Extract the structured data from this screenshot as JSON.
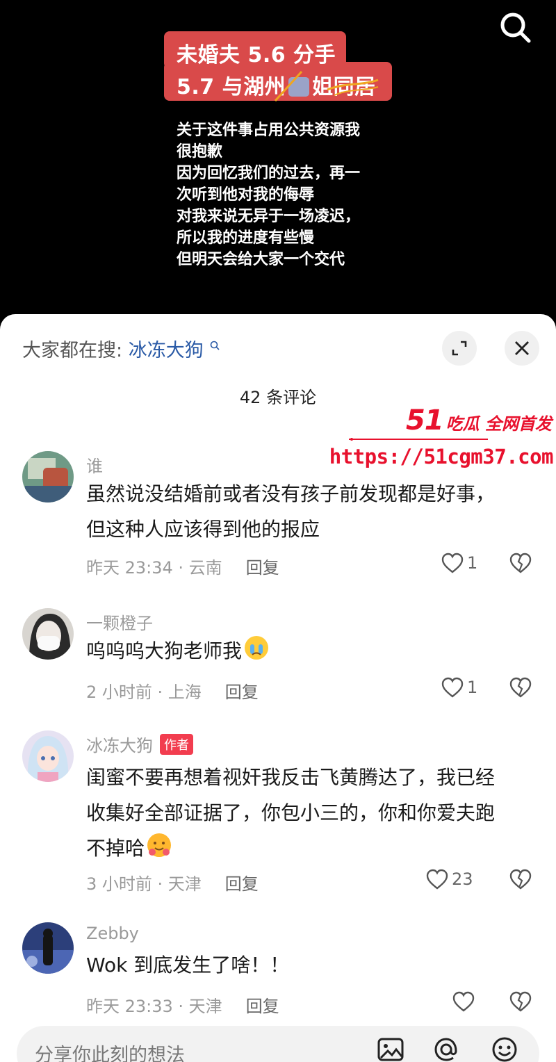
{
  "video": {
    "title_line1": "未婚夫 5.6 分手",
    "title_line2_pre": "5.7 与湖州",
    "title_line2_post": "姐同居",
    "statement_lines": [
      "关于这件事占用公共资源我",
      "很抱歉",
      "因为回忆我们的过去，再一",
      "次听到他对我的侮辱",
      "对我来说无异于一场凌迟，",
      "所以我的进度有些慢",
      "但明天会给大家一个交代"
    ]
  },
  "sheet": {
    "hot_search_label": "大家都在搜:",
    "hot_search_term": "冰冻大狗",
    "comment_count": "42 条评论"
  },
  "watermark": {
    "brand_number": "51",
    "slogan": "吃瓜 全网首发",
    "url": "https://51cgm37.com"
  },
  "comments": [
    {
      "name": "谁",
      "lines": [
        "虽然说没结婚前或者没有孩子前发现都是好事，",
        "但这种人应该得到他的报应"
      ],
      "time_loc": "昨天 23:34 · 云南",
      "reply": "回复",
      "likes": "1"
    },
    {
      "name": "一颗橙子",
      "lines": [
        "呜呜呜大狗老师我"
      ],
      "time_loc": "2 小时前 · 上海",
      "reply": "回复",
      "likes": "1"
    },
    {
      "name": "冰冻大狗",
      "author_tag": "作者",
      "lines": [
        "闺蜜不要再想着视奸我反击飞黄腾达了，我已经",
        "收集好全部证据了，你包小三的，你和你爱夫跑",
        "不掉哈"
      ],
      "time_loc": "3 小时前 · 天津",
      "reply": "回复",
      "likes": "23"
    },
    {
      "name": "Zebby",
      "lines": [
        "Wok 到底发生了啥！！"
      ],
      "time_loc": "昨天 23:33 · 天津",
      "reply": "回复",
      "likes": ""
    }
  ],
  "input": {
    "placeholder": "分享你此刻的想法"
  },
  "colors": {
    "title_bg": "#d94a4a",
    "author_tag": "#f23d4f",
    "link_blue": "#2a5aa6",
    "watermark_red": "#e8112d"
  }
}
